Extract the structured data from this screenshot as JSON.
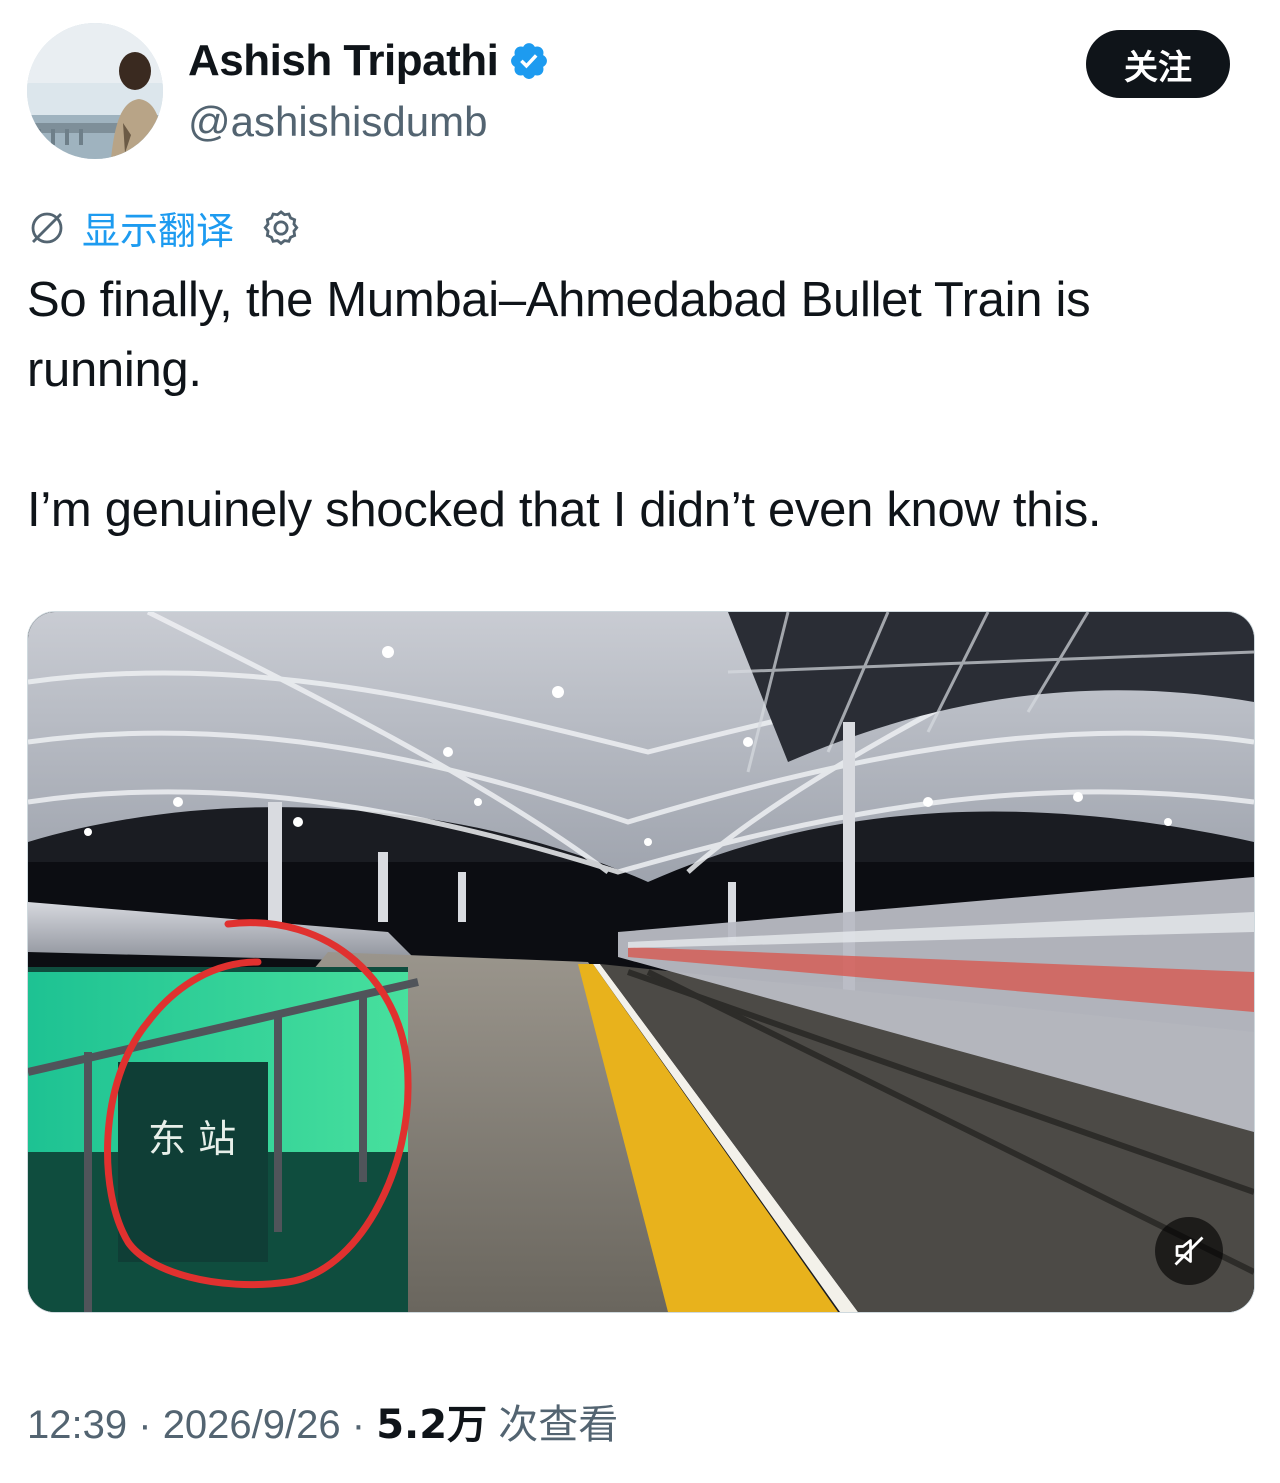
{
  "author": {
    "name": "Ashish Tripathi",
    "handle": "@ashishisdumb",
    "verified_icon": "verified-badge-icon",
    "accent_color": "#1d9bf0"
  },
  "follow_button": {
    "label": "关注"
  },
  "translate": {
    "label": "显示翻译",
    "icon": "translate-icon",
    "settings_icon": "gear-icon"
  },
  "tweet": {
    "paragraphs": [
      "So finally, the Mumbai–Ahmedabad Bullet Train is running.",
      "I’m genuinely shocked that I didn’t even know this."
    ]
  },
  "media": {
    "type": "video",
    "sign_text": "东 站",
    "mute_icon": "muted-speaker-icon",
    "annotation_color": "#e0312f"
  },
  "meta": {
    "time": "12:39",
    "separator": "·",
    "date": "2026/9/26",
    "views_count": "5.2万",
    "views_label": "次查看"
  }
}
